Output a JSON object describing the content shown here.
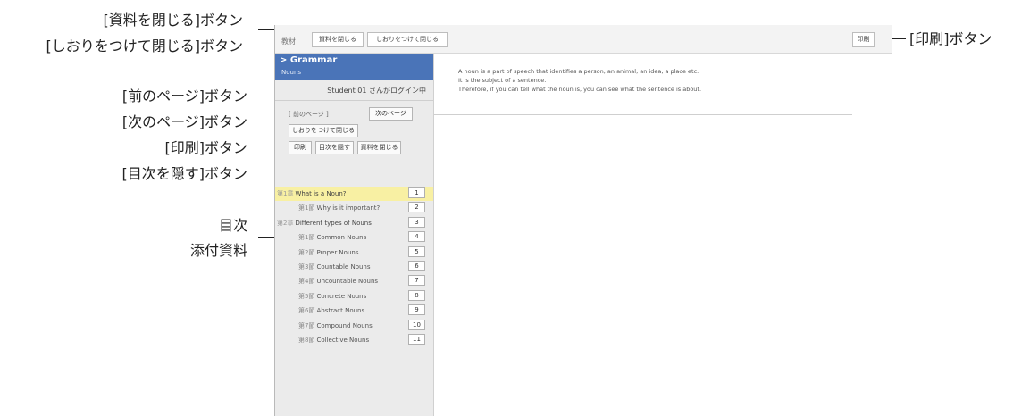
{
  "annotations": {
    "close_material": "[資料を閉じる]ボタン",
    "bookmark_close": "[しおりをつけて閉じる]ボタン",
    "print_top": "[印刷]ボタン",
    "prev_page": "[前のページ]ボタン",
    "next_page": "[次のページ]ボタン",
    "print_side": "[印刷]ボタン",
    "hide_toc": "[目次を隠す]ボタン",
    "toc": "目次",
    "attachments": "添付資料"
  },
  "topbar": {
    "tab_label": "教材",
    "close_material_label": "資料を閉じる",
    "bookmark_close_label": "しおりをつけて閉じる",
    "print_label": "印刷"
  },
  "sidebar": {
    "section_title": "> Grammar",
    "section_subtitle": "Nouns",
    "login_text": "Student 01 さんがログイン中",
    "prev_label": "[ 前のページ ]",
    "next_label": "次のページ",
    "bookmark_close_label": "しおりをつけて閉じる",
    "print_label": "印刷",
    "hide_toc_label": "目次を隠す",
    "close_material_label": "資料を閉じる"
  },
  "toc": {
    "items": [
      {
        "num": "第1章",
        "title": "What is a Noun?",
        "page": "1"
      },
      {
        "num": "第1節",
        "title": "Why is it important?",
        "page": "2"
      },
      {
        "num": "第2章",
        "title": "Different types of Nouns",
        "page": "3"
      },
      {
        "num": "第1節",
        "title": "Common Nouns",
        "page": "4"
      },
      {
        "num": "第2節",
        "title": "Proper Nouns",
        "page": "5"
      },
      {
        "num": "第3節",
        "title": "Countable Nouns",
        "page": "6"
      },
      {
        "num": "第4節",
        "title": "Uncountable Nouns",
        "page": "7"
      },
      {
        "num": "第5節",
        "title": "Concrete Nouns",
        "page": "8"
      },
      {
        "num": "第6節",
        "title": "Abstract Nouns",
        "page": "9"
      },
      {
        "num": "第7節",
        "title": "Compound Nouns",
        "page": "10"
      },
      {
        "num": "第8節",
        "title": "Collective Nouns",
        "page": "11"
      }
    ]
  },
  "main": {
    "lines": [
      "A noun is a part of speech that identifies a person, an animal, an idea, a place etc.",
      "It is the subject of a sentence.",
      "Therefore, if you can tell what the noun is, you can see what the sentence is about."
    ]
  },
  "colors": {
    "header_blue": "#4a74b8",
    "toc_highlight": "#f8f0a3",
    "sidebar_bg": "#ebebeb"
  }
}
